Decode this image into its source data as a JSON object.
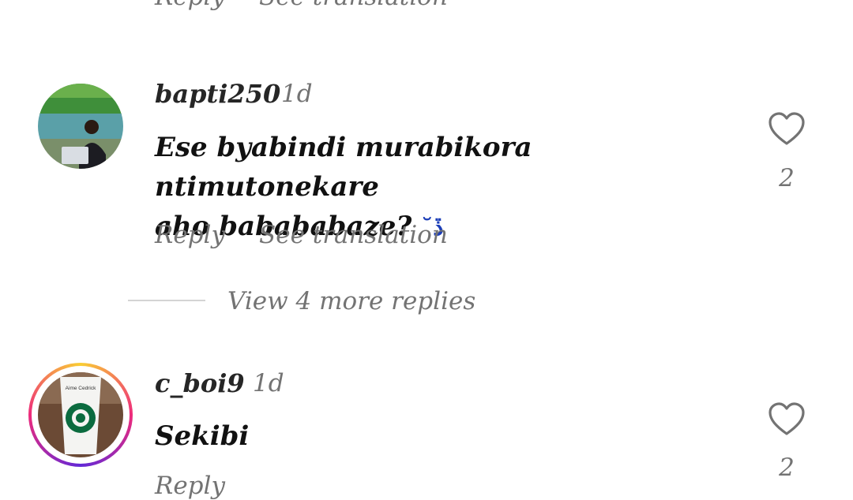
{
  "top_comment_actions": {
    "reply": "Reply",
    "see_translation": "See translation"
  },
  "comments": [
    {
      "username": "bapti250",
      "time": "1d",
      "text_line1": "Ese byabindi murabikora ntimutonekare",
      "text_line2": "aho babababaze?",
      "emoji": "˘ڏ",
      "likes": "2",
      "reply": "Reply",
      "see_translation": "See translation",
      "view_replies": "View 4 more replies"
    },
    {
      "username": "c_boi9",
      "time": "1d",
      "text": "Sekibi",
      "likes": "2",
      "reply": "Reply",
      "cup_text": "Aime Cedrick"
    }
  ],
  "colors": {
    "story_ring_start": "#f9ce34",
    "story_ring_mid": "#ee2a7b",
    "story_ring_end": "#6228d7"
  }
}
